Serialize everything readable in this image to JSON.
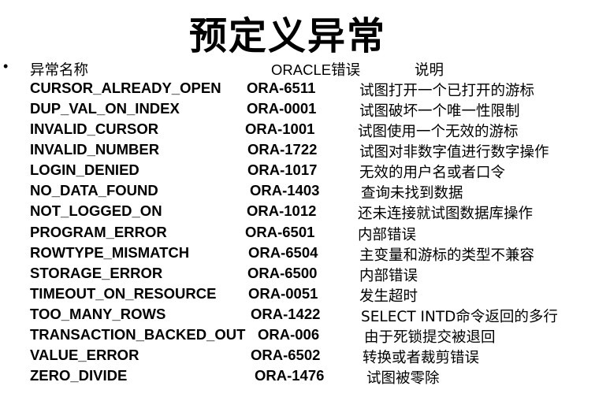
{
  "title": "预定义异常",
  "header": {
    "name": "异常名称",
    "code": "ORACLE错误",
    "desc": "说明"
  },
  "rows": [
    {
      "name": "CURSOR_ALREADY_OPEN",
      "code": "ORA-6511",
      "desc": "试图打开一个已打开的游标"
    },
    {
      "name": "DUP_VAL_ON_INDEX",
      "code": "ORA-0001",
      "desc": "试图破坏一个唯一性限制"
    },
    {
      "name": "INVALID_CURSOR",
      "code": "ORA-1001",
      "desc": "试图使用一个无效的游标"
    },
    {
      "name": "INVALID_NUMBER",
      "code": "ORA-1722",
      "desc": "试图对非数字值进行数字操作"
    },
    {
      "name": "LOGIN_DENIED",
      "code": "ORA-1017",
      "desc": "无效的用户名或者口令"
    },
    {
      "name": "NO_DATA_FOUND",
      "code": "ORA-1403",
      "desc": "查询未找到数据"
    },
    {
      "name": "NOT_LOGGED_ON",
      "code": "ORA-1012",
      "desc": "还未连接就试图数据库操作"
    },
    {
      "name": "PROGRAM_ERROR",
      "code": "ORA-6501",
      "desc": "内部错误"
    },
    {
      "name": "ROWTYPE_MISMATCH",
      "code": "ORA-6504",
      "desc": "主变量和游标的类型不兼容"
    },
    {
      "name": "STORAGE_ERROR",
      "code": "ORA-6500",
      "desc": "内部错误"
    },
    {
      "name": "TIMEOUT_ON_RESOURCE",
      "code": "ORA-0051",
      "desc": "发生超时"
    },
    {
      "name": "TOO_MANY_ROWS",
      "code": "ORA-1422",
      "desc": "SELECT INTD命令返回的多行"
    },
    {
      "name": "TRANSACTION_BACKED_OUT",
      "code": "ORA-006",
      "desc": "由于死锁提交被退回"
    },
    {
      "name": "VALUE_ERROR",
      "code": "ORA-6502",
      "desc": "转换或者裁剪错误"
    },
    {
      "name": "ZERO_DIVIDE",
      "code": "ORA-1476",
      "desc": "试图被零除"
    }
  ]
}
